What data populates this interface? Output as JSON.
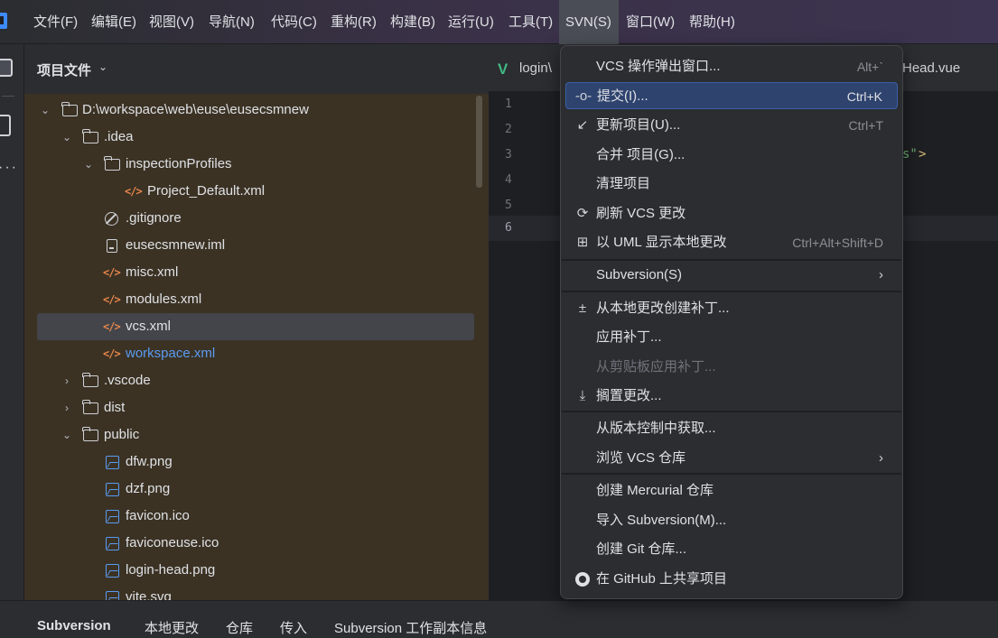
{
  "menubar": {
    "items": [
      "文件(F)",
      "编辑(E)",
      "视图(V)",
      "导航(N)",
      "代码(C)",
      "重构(R)",
      "构建(B)",
      "运行(U)",
      "工具(T)",
      "SVN(S)",
      "窗口(W)",
      "帮助(H)"
    ],
    "active_index": 9
  },
  "project": {
    "title": "项目文件",
    "tree": [
      {
        "label": "D:\\workspace\\web\\euse\\eusecsmnew",
        "type": "folder",
        "expanded": true
      },
      {
        "label": ".idea",
        "type": "folder",
        "expanded": true
      },
      {
        "label": "inspectionProfiles",
        "type": "folder",
        "expanded": true
      },
      {
        "label": "Project_Default.xml",
        "type": "xml"
      },
      {
        "label": ".gitignore",
        "type": "ignore"
      },
      {
        "label": "eusecsmnew.iml",
        "type": "iml"
      },
      {
        "label": "misc.xml",
        "type": "xml"
      },
      {
        "label": "modules.xml",
        "type": "xml"
      },
      {
        "label": "vcs.xml",
        "type": "xml",
        "selected": true
      },
      {
        "label": "workspace.xml",
        "type": "xml",
        "modified": true
      },
      {
        "label": ".vscode",
        "type": "folder",
        "expanded": false
      },
      {
        "label": "dist",
        "type": "folder",
        "expanded": false
      },
      {
        "label": "public",
        "type": "folder",
        "expanded": true
      },
      {
        "label": "dfw.png",
        "type": "image"
      },
      {
        "label": "dzf.png",
        "type": "image"
      },
      {
        "label": "favicon.ico",
        "type": "image"
      },
      {
        "label": "faviconeuse.ico",
        "type": "image"
      },
      {
        "label": "login-head.png",
        "type": "image"
      },
      {
        "label": "vite.svg",
        "type": "image"
      }
    ]
  },
  "editor": {
    "tab_left": "login\\",
    "tab_right": "Head.vue",
    "line_numbers": [
      "1",
      "2",
      "3",
      "4",
      "5",
      "6"
    ],
    "current_line": "6",
    "code_fragment_string": "s\"",
    "code_fragment_tag": ">"
  },
  "svn_menu": {
    "items": [
      {
        "label": "VCS 操作弹出窗口...",
        "shortcut": "Alt+`"
      },
      {
        "label": "提交(I)...",
        "shortcut": "Ctrl+K",
        "icon": "commit-icon",
        "highlighted": true
      },
      {
        "label": "更新项目(U)...",
        "shortcut": "Ctrl+T",
        "icon": "update-arrow-icon"
      },
      {
        "label": "合并 项目(G)..."
      },
      {
        "label": "清理项目"
      },
      {
        "label": "刷新 VCS 更改",
        "icon": "refresh-icon"
      },
      {
        "label": "以 UML 显示本地更改",
        "shortcut": "Ctrl+Alt+Shift+D",
        "icon": "uml-diagram-icon"
      },
      {
        "label": "Subversion(S)",
        "submenu": true
      },
      {
        "label": "从本地更改创建补丁...",
        "icon": "patch-plus-minus-icon"
      },
      {
        "label": "应用补丁..."
      },
      {
        "label": "从剪贴板应用补丁...",
        "disabled": true
      },
      {
        "label": "搁置更改...",
        "icon": "shelve-download-icon"
      },
      {
        "label": "从版本控制中获取..."
      },
      {
        "label": "浏览 VCS 仓库",
        "submenu": true
      },
      {
        "label": "创建 Mercurial 仓库"
      },
      {
        "label": "导入 Subversion(M)..."
      },
      {
        "label": "创建 Git 仓库..."
      },
      {
        "label": "在 GitHub 上共享项目",
        "icon": "github-icon"
      }
    ],
    "submenu_arrow": "›"
  },
  "bottom_tabs": [
    "Subversion",
    "本地更改",
    "仓库",
    "传入",
    "Subversion 工作副本信息"
  ],
  "colors": {
    "accent_highlight": "#2e436e",
    "tree_background": "#3b3224",
    "xml_icon": "#e8864a",
    "image_icon": "#5a9bf0",
    "modified_file": "#5a9bf0",
    "vue_icon": "#41b883",
    "string_color": "#6aab73"
  },
  "icons": {
    "chevron_down": "⌄",
    "arrow_expanded": "⌄",
    "arrow_collapsed": "›",
    "vue": "V"
  }
}
